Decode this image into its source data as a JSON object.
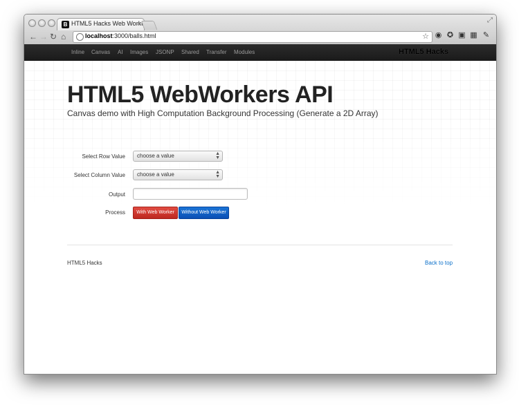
{
  "browser": {
    "tab_title": "HTML5 Hacks Web Workers",
    "tab_favicon": "B",
    "tab_close": "×",
    "url_host": "localhost",
    "url_rest": ":3000/balls.html",
    "nav_icons": [
      "back-arrow-icon",
      "forward-arrow-icon",
      "reload-icon",
      "home-icon"
    ],
    "extension_icons": [
      "star-icon",
      "extension-icon",
      "extension-icon",
      "extension-icon",
      "extension-icon",
      "wrench-icon"
    ]
  },
  "navbar": {
    "links": [
      "Inline",
      "Canvas",
      "AI",
      "Images",
      "JSONP",
      "Shared",
      "Transfer",
      "Modules"
    ],
    "brand": "HTML5 Hacks"
  },
  "page": {
    "title": "HTML5 WebWorkers API",
    "subtitle": "Canvas demo with High Computation Background Processing (Generate a 2D Array)"
  },
  "form": {
    "row_label": "Select Row Value",
    "row_value": "choose a value",
    "column_label": "Select Column Value",
    "column_value": "choose a value",
    "output_label": "Output",
    "output_value": "",
    "process_label": "Process",
    "with_worker_button": "With Web Worker",
    "without_worker_button": "Without Web Worker"
  },
  "footer": {
    "left_text": "HTML5 Hacks",
    "back_to_top": "Back to top"
  },
  "colors": {
    "navbar_bg": "#1b1b1b",
    "danger_button": "#c9302c",
    "primary_button": "#0e5fc6",
    "link": "#0a6fc9"
  }
}
